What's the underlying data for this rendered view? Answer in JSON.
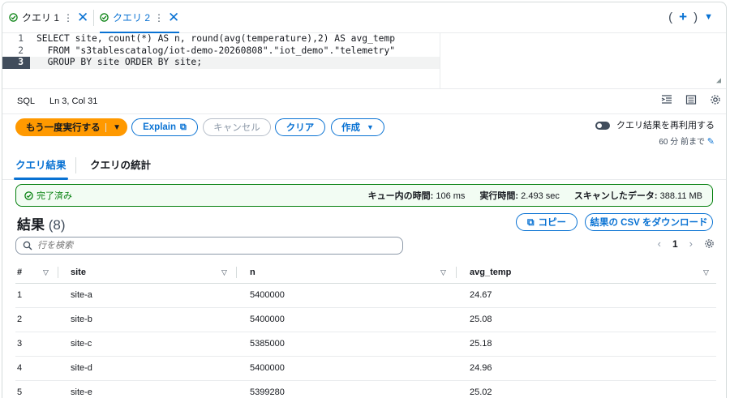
{
  "tabs": [
    {
      "label": "クエリ 1",
      "active": false
    },
    {
      "label": "クエリ 2",
      "active": true
    }
  ],
  "tab_actions": {
    "add": "+",
    "open_paren": "(",
    "close_paren": ")"
  },
  "editor": {
    "line_numbers": [
      "1",
      "2",
      "3"
    ],
    "lines": [
      "SELECT site, count(*) AS n, round(avg(temperature),2) AS avg_temp",
      "  FROM \"s3tablescatalog/iot-demo-20260808\".\"iot_demo\".\"telemetry\"",
      "  GROUP BY site ORDER BY site;"
    ]
  },
  "statusbar": {
    "language": "SQL",
    "cursor": "Ln 3, Col 31"
  },
  "actions": {
    "run_again": "もう一度実行する",
    "explain": "Explain",
    "cancel": "キャンセル",
    "clear": "クリア",
    "create": "作成"
  },
  "reuse": {
    "label": "クエリ結果を再利用する",
    "sub": "60 分 前まで"
  },
  "result_tabs": [
    "クエリ結果",
    "クエリの統計"
  ],
  "banner": {
    "status": "完了済み",
    "queue_label": "キュー内の時間:",
    "queue_value": "106 ms",
    "exec_label": "実行時間:",
    "exec_value": "2.493 sec",
    "scan_label": "スキャンしたデータ:",
    "scan_value": "388.11 MB"
  },
  "results": {
    "title": "結果",
    "count": "(8)",
    "copy": "コピー",
    "download": "結果の CSV をダウンロード",
    "search_placeholder": "行を検索",
    "page": "1"
  },
  "table": {
    "columns": [
      "#",
      "site",
      "n",
      "avg_temp"
    ],
    "rows": [
      [
        "1",
        "site-a",
        "5400000",
        "24.67"
      ],
      [
        "2",
        "site-b",
        "5400000",
        "25.08"
      ],
      [
        "3",
        "site-c",
        "5385000",
        "25.18"
      ],
      [
        "4",
        "site-d",
        "5400000",
        "24.96"
      ],
      [
        "5",
        "site-e",
        "5399280",
        "25.02"
      ]
    ]
  },
  "colors": {
    "accent": "#0972d3",
    "primary_button": "#ff9900",
    "success": "#037f0c"
  }
}
